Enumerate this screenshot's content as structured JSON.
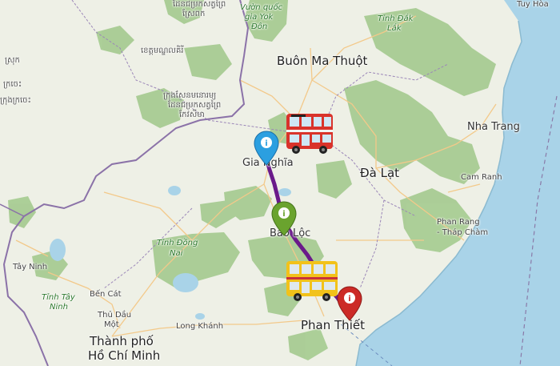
{
  "map": {
    "cities": {
      "buon_ma_thuot": "Buôn Ma Thuột",
      "gia_nghia": "Gia Nghĩa",
      "da_lat": "Đà Lạt",
      "bao_loc": "Bảo Lộc",
      "phan_thiet": "Phan Thiết",
      "nha_trang": "Nha Trang",
      "cam_ranh": "Cam Ranh",
      "phan_rang_1": "Phan Rang",
      "phan_rang_2": "- Tháp Chàm",
      "tuy_hoa": "Tuy Hòa",
      "ho_chi_minh_1": "Thành phố",
      "ho_chi_minh_2": "Hồ Chí Minh",
      "long_khanh": "Long Khánh",
      "tay_ninh": "Tây Ninh",
      "ben_cat": "Bến Cát",
      "thu_dau_mot_1": "Thủ Dầu",
      "thu_dau_mot_2": "Một"
    },
    "regions": {
      "dak_lak_1": "Tỉnh Đắk",
      "dak_lak_2": "Lắk",
      "dong_nai_1": "Tỉnh Đồng",
      "dong_nai_2": "Nai",
      "tay_ninh_prov_1": "Tỉnh Tây",
      "tay_ninh_prov_2": "Ninh",
      "yok_don_1": "Vườn quốc",
      "yok_don_2": "gia Yok",
      "yok_don_3": "Đôn"
    },
    "khmer_labels": {
      "k1": "ដែនជម្រកសត្វព្រៃ",
      "k2": "ស្រែពក",
      "k3": "ខេត្តមណ្ឌលគិរី",
      "k4": "ក្រុងសែនមនោរម្យ",
      "k5": "ដែនជម្រកសត្វព្រៃ",
      "k6": "កែវសីមា",
      "k7": "ស្រុក",
      "k8": "ក្រចេះ",
      "k9": "ក្រុងក្រចេះ"
    },
    "pins": [
      {
        "name": "Gia Nghĩa",
        "color": "#2b9fe0",
        "icon": "info-icon"
      },
      {
        "name": "Bảo Lộc",
        "color": "#6aa32e",
        "icon": "info-icon"
      },
      {
        "name": "Phan Thiết",
        "color": "#cc2a26",
        "icon": "info-icon"
      }
    ],
    "route_color": "#6a1a8a",
    "sea_color": "#a9d3e8",
    "forest_color": "#a8cc93"
  }
}
